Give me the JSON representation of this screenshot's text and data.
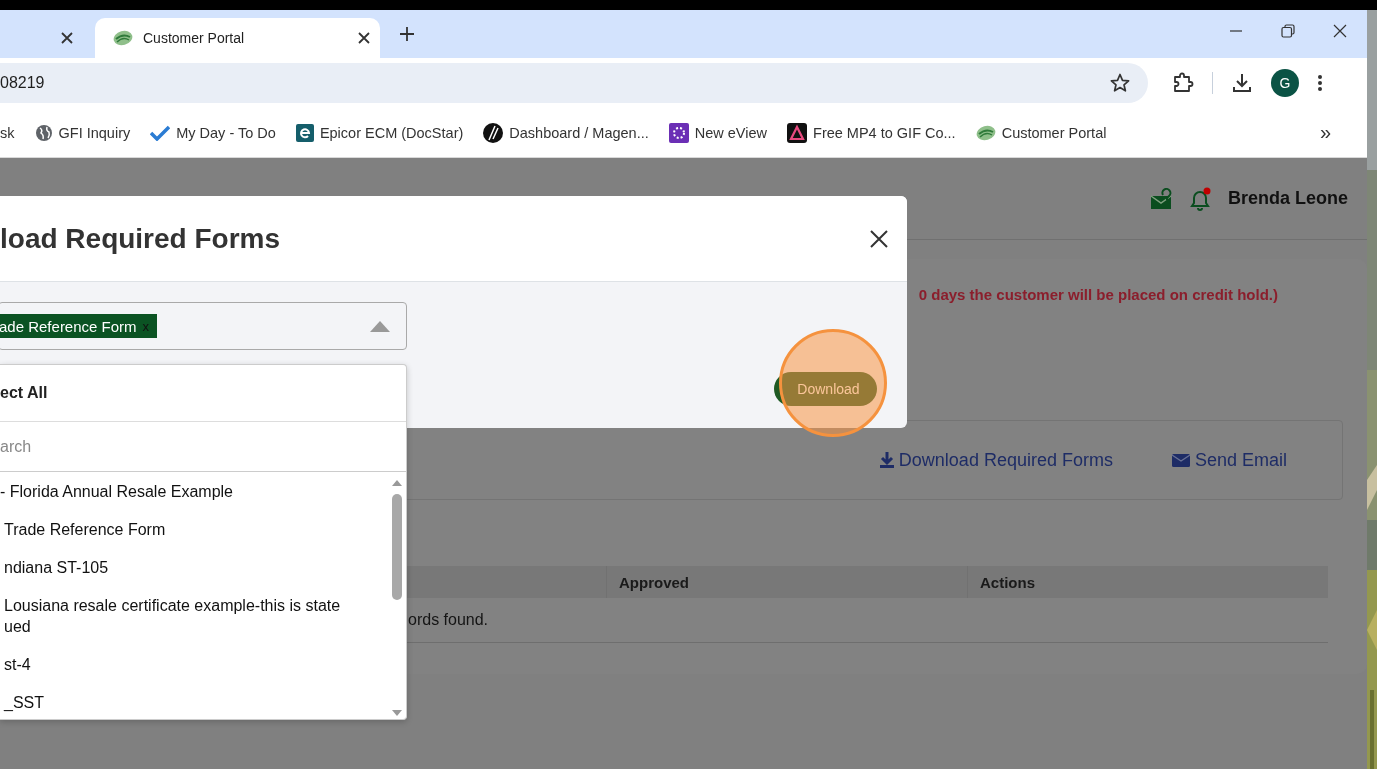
{
  "browser": {
    "tabs": [
      {
        "selected": false
      },
      {
        "title": "Customer Portal",
        "selected": true
      }
    ],
    "address": "08219",
    "profile_initial": "G",
    "bookmarks": [
      {
        "label": "sk"
      },
      {
        "label": "GFI Inquiry"
      },
      {
        "label": "My Day - To Do"
      },
      {
        "label": "Epicor ECM (DocStar)"
      },
      {
        "label": "Dashboard / Magen..."
      },
      {
        "label": "New eView"
      },
      {
        "label": "Free MP4 to GIF Co..."
      },
      {
        "label": "Customer Portal"
      }
    ],
    "bookmarks_overflow": "»"
  },
  "header": {
    "user_name": "Brenda Leone",
    "unread": true
  },
  "notice": "0 days the customer will be placed on credit hold.)",
  "actions": [
    {
      "label": "Download Required Forms"
    },
    {
      "label": "Send Email"
    }
  ],
  "table": {
    "columns": [
      {
        "label": "Approved"
      },
      {
        "label": "Actions"
      }
    ],
    "empty_message": "ords found."
  },
  "modal": {
    "title": "load Required Forms",
    "selected_tags": [
      {
        "label": "ade Reference Form",
        "remove": "x"
      }
    ],
    "dropdown": {
      "select_all": "ect All",
      "search_placeholder": "arch",
      "options": [
        {
          "lines": [
            "- Florida Annual Resale Example"
          ]
        },
        {
          "lines": [
            "Trade Reference Form"
          ]
        },
        {
          "lines": [
            "ndiana ST-105"
          ]
        },
        {
          "lines": [
            "Lousiana resale certificate example-this is state",
            "ued"
          ]
        },
        {
          "lines": [
            "st-4"
          ]
        },
        {
          "lines": [
            "_SST"
          ]
        }
      ]
    },
    "download_button": "Download"
  }
}
